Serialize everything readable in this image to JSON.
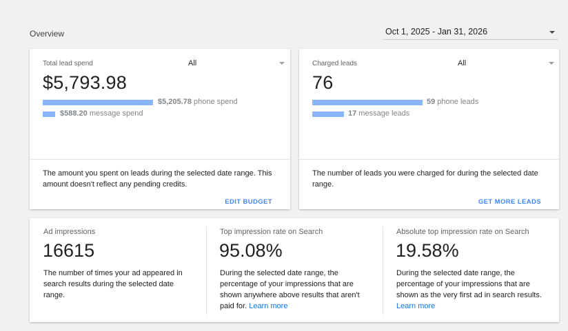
{
  "header": {
    "title": "Overview",
    "date_range": "Oct 1, 2025 - Jan 31, 2026"
  },
  "lead_spend": {
    "label": "Total lead spend",
    "filter": "All",
    "value": "$5,793.98",
    "bars": [
      {
        "amount": "$5,205.78",
        "text": " phone spend",
        "fraction": 1.0
      },
      {
        "amount": "$588.20",
        "text": " message spend",
        "fraction": 0.113
      }
    ],
    "description": "The amount you spent on leads during the selected date range. This amount doesn't reflect any pending credits.",
    "action": "EDIT BUDGET"
  },
  "charged_leads": {
    "label": "Charged leads",
    "filter": "All",
    "value": "76",
    "bars": [
      {
        "amount": "59",
        "text": " phone leads",
        "fraction": 1.0
      },
      {
        "amount": "17",
        "text": " message leads",
        "fraction": 0.288
      }
    ],
    "description": "The number of leads you were charged for during the selected date range.",
    "action": "GET MORE LEADS"
  },
  "metrics": [
    {
      "label": "Ad impressions",
      "value": "16615",
      "description": "The number of times your ad appeared in search results during the selected date range.",
      "link": ""
    },
    {
      "label": "Top impression rate on Search",
      "value": "95.08%",
      "description": "During the selected date range, the percentage of your impressions that are shown anywhere above results that aren't paid for.",
      "link": "Learn more"
    },
    {
      "label": "Absolute top impression rate on Search",
      "value": "19.58%",
      "description": "During the selected date range, the percentage of your impressions that are shown as the very first ad in search results.",
      "link": "Learn more"
    }
  ],
  "colors": {
    "accent": "#4285f4",
    "bar": "#8ab4f8",
    "link": "#1a73e8"
  }
}
